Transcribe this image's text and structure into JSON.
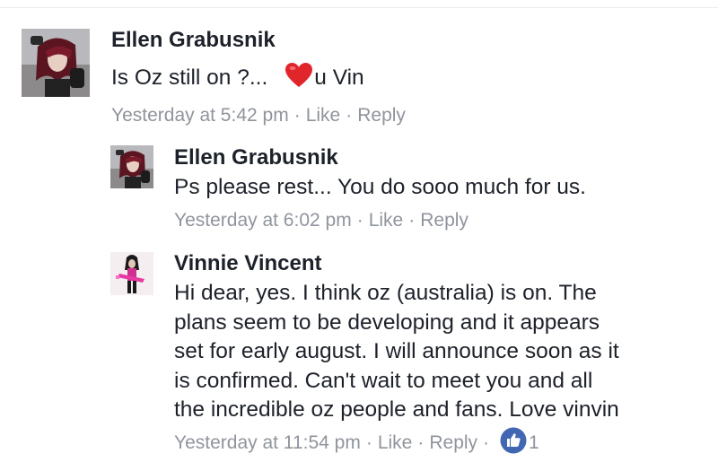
{
  "comments": [
    {
      "author": "Ellen Grabusnik",
      "text_before_heart": "Is Oz still on ?...",
      "text_after_heart": "u Vin",
      "time": "Yesterday at 5:42 pm",
      "like": "Like",
      "reply": "Reply"
    },
    {
      "author": "Ellen Grabusnik",
      "text": "Ps please rest... You do sooo much for us.",
      "time": "Yesterday at 6:02 pm",
      "like": "Like",
      "reply": "Reply"
    },
    {
      "author": "Vinnie Vincent",
      "lines": [
        "Hi dear, yes. I think oz  (australia) is on.  The",
        "plans seem to be developing and it appears",
        "set for early august. I will announce soon as it",
        "is confirmed. Can't wait to meet you and all",
        "the incredible oz people and fans. Love vinvin"
      ],
      "time": "Yesterday at 11:54 pm",
      "like": "Like",
      "reply": "Reply",
      "reaction_icon": "thumbs-up-icon",
      "reaction_count": "1"
    }
  ],
  "colors": {
    "text": "#1d2129",
    "meta": "#90949c",
    "like_blue": "#4267b2",
    "heart_red": "#e0252b"
  }
}
